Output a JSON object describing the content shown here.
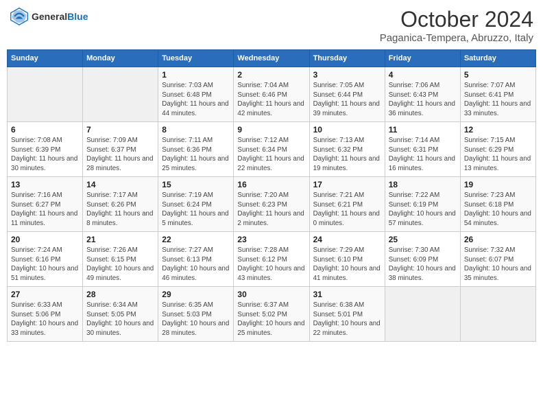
{
  "header": {
    "logo_line1": "General",
    "logo_line2": "Blue",
    "month": "October 2024",
    "location": "Paganica-Tempera, Abruzzo, Italy"
  },
  "columns": [
    "Sunday",
    "Monday",
    "Tuesday",
    "Wednesday",
    "Thursday",
    "Friday",
    "Saturday"
  ],
  "weeks": [
    [
      {
        "day": "",
        "info": ""
      },
      {
        "day": "",
        "info": ""
      },
      {
        "day": "1",
        "info": "Sunrise: 7:03 AM\nSunset: 6:48 PM\nDaylight: 11 hours and 44 minutes."
      },
      {
        "day": "2",
        "info": "Sunrise: 7:04 AM\nSunset: 6:46 PM\nDaylight: 11 hours and 42 minutes."
      },
      {
        "day": "3",
        "info": "Sunrise: 7:05 AM\nSunset: 6:44 PM\nDaylight: 11 hours and 39 minutes."
      },
      {
        "day": "4",
        "info": "Sunrise: 7:06 AM\nSunset: 6:43 PM\nDaylight: 11 hours and 36 minutes."
      },
      {
        "day": "5",
        "info": "Sunrise: 7:07 AM\nSunset: 6:41 PM\nDaylight: 11 hours and 33 minutes."
      }
    ],
    [
      {
        "day": "6",
        "info": "Sunrise: 7:08 AM\nSunset: 6:39 PM\nDaylight: 11 hours and 30 minutes."
      },
      {
        "day": "7",
        "info": "Sunrise: 7:09 AM\nSunset: 6:37 PM\nDaylight: 11 hours and 28 minutes."
      },
      {
        "day": "8",
        "info": "Sunrise: 7:11 AM\nSunset: 6:36 PM\nDaylight: 11 hours and 25 minutes."
      },
      {
        "day": "9",
        "info": "Sunrise: 7:12 AM\nSunset: 6:34 PM\nDaylight: 11 hours and 22 minutes."
      },
      {
        "day": "10",
        "info": "Sunrise: 7:13 AM\nSunset: 6:32 PM\nDaylight: 11 hours and 19 minutes."
      },
      {
        "day": "11",
        "info": "Sunrise: 7:14 AM\nSunset: 6:31 PM\nDaylight: 11 hours and 16 minutes."
      },
      {
        "day": "12",
        "info": "Sunrise: 7:15 AM\nSunset: 6:29 PM\nDaylight: 11 hours and 13 minutes."
      }
    ],
    [
      {
        "day": "13",
        "info": "Sunrise: 7:16 AM\nSunset: 6:27 PM\nDaylight: 11 hours and 11 minutes."
      },
      {
        "day": "14",
        "info": "Sunrise: 7:17 AM\nSunset: 6:26 PM\nDaylight: 11 hours and 8 minutes."
      },
      {
        "day": "15",
        "info": "Sunrise: 7:19 AM\nSunset: 6:24 PM\nDaylight: 11 hours and 5 minutes."
      },
      {
        "day": "16",
        "info": "Sunrise: 7:20 AM\nSunset: 6:23 PM\nDaylight: 11 hours and 2 minutes."
      },
      {
        "day": "17",
        "info": "Sunrise: 7:21 AM\nSunset: 6:21 PM\nDaylight: 11 hours and 0 minutes."
      },
      {
        "day": "18",
        "info": "Sunrise: 7:22 AM\nSunset: 6:19 PM\nDaylight: 10 hours and 57 minutes."
      },
      {
        "day": "19",
        "info": "Sunrise: 7:23 AM\nSunset: 6:18 PM\nDaylight: 10 hours and 54 minutes."
      }
    ],
    [
      {
        "day": "20",
        "info": "Sunrise: 7:24 AM\nSunset: 6:16 PM\nDaylight: 10 hours and 51 minutes."
      },
      {
        "day": "21",
        "info": "Sunrise: 7:26 AM\nSunset: 6:15 PM\nDaylight: 10 hours and 49 minutes."
      },
      {
        "day": "22",
        "info": "Sunrise: 7:27 AM\nSunset: 6:13 PM\nDaylight: 10 hours and 46 minutes."
      },
      {
        "day": "23",
        "info": "Sunrise: 7:28 AM\nSunset: 6:12 PM\nDaylight: 10 hours and 43 minutes."
      },
      {
        "day": "24",
        "info": "Sunrise: 7:29 AM\nSunset: 6:10 PM\nDaylight: 10 hours and 41 minutes."
      },
      {
        "day": "25",
        "info": "Sunrise: 7:30 AM\nSunset: 6:09 PM\nDaylight: 10 hours and 38 minutes."
      },
      {
        "day": "26",
        "info": "Sunrise: 7:32 AM\nSunset: 6:07 PM\nDaylight: 10 hours and 35 minutes."
      }
    ],
    [
      {
        "day": "27",
        "info": "Sunrise: 6:33 AM\nSunset: 5:06 PM\nDaylight: 10 hours and 33 minutes."
      },
      {
        "day": "28",
        "info": "Sunrise: 6:34 AM\nSunset: 5:05 PM\nDaylight: 10 hours and 30 minutes."
      },
      {
        "day": "29",
        "info": "Sunrise: 6:35 AM\nSunset: 5:03 PM\nDaylight: 10 hours and 28 minutes."
      },
      {
        "day": "30",
        "info": "Sunrise: 6:37 AM\nSunset: 5:02 PM\nDaylight: 10 hours and 25 minutes."
      },
      {
        "day": "31",
        "info": "Sunrise: 6:38 AM\nSunset: 5:01 PM\nDaylight: 10 hours and 22 minutes."
      },
      {
        "day": "",
        "info": ""
      },
      {
        "day": "",
        "info": ""
      }
    ]
  ]
}
